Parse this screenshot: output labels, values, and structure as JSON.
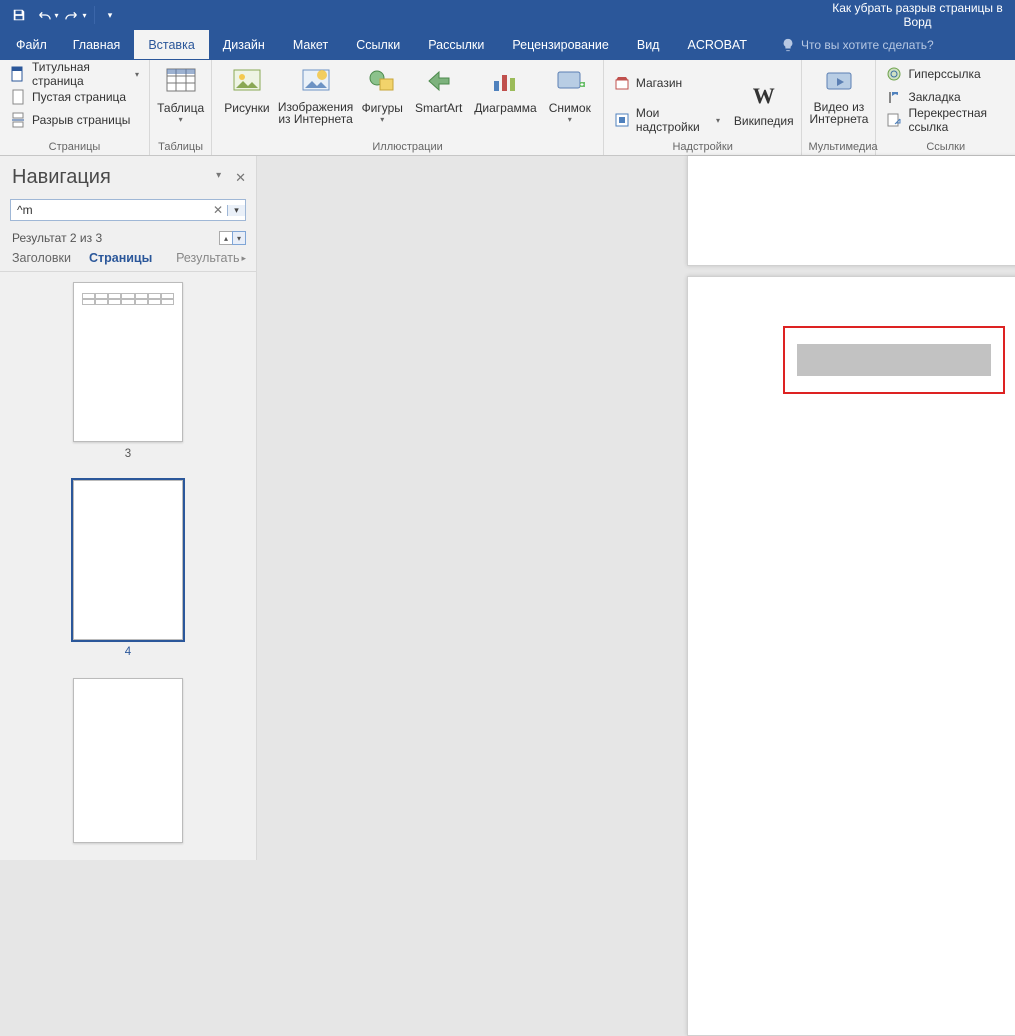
{
  "title": "Как убрать разрыв страницы в Ворд",
  "qat": {
    "save": "save-icon",
    "undo": "undo-icon",
    "redo": "redo-icon"
  },
  "tabs": {
    "file": "Файл",
    "home": "Главная",
    "insert": "Вставка",
    "design": "Дизайн",
    "layout": "Макет",
    "references": "Ссылки",
    "mailings": "Рассылки",
    "review": "Рецензирование",
    "view": "Вид",
    "acrobat": "ACROBAT",
    "tellme": "Что вы хотите сделать?"
  },
  "ribbon": {
    "pages": {
      "label": "Страницы",
      "cover": "Титульная страница",
      "blank": "Пустая страница",
      "break": "Разрыв страницы"
    },
    "tables": {
      "label": "Таблицы",
      "table": "Таблица"
    },
    "illustrations": {
      "label": "Иллюстрации",
      "pictures": "Рисунки",
      "online": "Изображения из Интернета",
      "shapes": "Фигуры",
      "smartart": "SmartArt",
      "chart": "Диаграмма",
      "screenshot": "Снимок"
    },
    "addins": {
      "label": "Надстройки",
      "store": "Магазин",
      "myaddins": "Мои надстройки",
      "wikipedia": "Википедия"
    },
    "media": {
      "label": "Мультимедиа",
      "video": "Видео из Интернета"
    },
    "links": {
      "label": "Ссылки",
      "hyperlink": "Гиперссылка",
      "bookmark": "Закладка",
      "crossref": "Перекрестная ссылка"
    }
  },
  "nav": {
    "title": "Навигация",
    "search_value": "^m",
    "result_text": "Результат 2 из 3",
    "tabs": {
      "headings": "Заголовки",
      "pages": "Страницы",
      "results": "Результать"
    },
    "thumbs": [
      {
        "num": "3",
        "selected": false,
        "has_table": true
      },
      {
        "num": "4",
        "selected": true,
        "has_table": false
      },
      {
        "num": "",
        "selected": false,
        "has_table": false
      }
    ]
  }
}
